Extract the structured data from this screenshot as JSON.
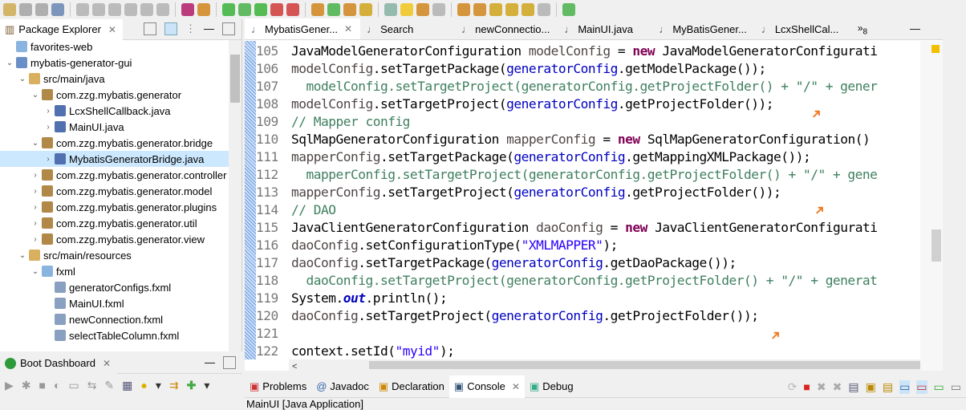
{
  "package_explorer": {
    "title": "Package Explorer",
    "tree": [
      {
        "label": "favorites-web",
        "depth": 0,
        "expanded": null,
        "icon": "folder-icon"
      },
      {
        "label": "mybatis-generator-gui",
        "depth": 0,
        "expanded": true,
        "icon": "maven-project-icon"
      },
      {
        "label": "src/main/java",
        "depth": 1,
        "expanded": true,
        "icon": "source-folder-icon"
      },
      {
        "label": "com.zzg.mybatis.generator",
        "depth": 2,
        "expanded": true,
        "icon": "package-icon"
      },
      {
        "label": "LcxShellCallback.java",
        "depth": 3,
        "expanded": false,
        "icon": "java-file-icon"
      },
      {
        "label": "MainUI.java",
        "depth": 3,
        "expanded": false,
        "icon": "java-file-icon"
      },
      {
        "label": "com.zzg.mybatis.generator.bridge",
        "depth": 2,
        "expanded": true,
        "icon": "package-icon"
      },
      {
        "label": "MybatisGeneratorBridge.java",
        "depth": 3,
        "expanded": false,
        "icon": "java-file-icon",
        "selected": true
      },
      {
        "label": "com.zzg.mybatis.generator.controller",
        "depth": 2,
        "expanded": false,
        "icon": "package-icon"
      },
      {
        "label": "com.zzg.mybatis.generator.model",
        "depth": 2,
        "expanded": false,
        "icon": "package-icon"
      },
      {
        "label": "com.zzg.mybatis.generator.plugins",
        "depth": 2,
        "expanded": false,
        "icon": "package-icon"
      },
      {
        "label": "com.zzg.mybatis.generator.util",
        "depth": 2,
        "expanded": false,
        "icon": "package-icon"
      },
      {
        "label": "com.zzg.mybatis.generator.view",
        "depth": 2,
        "expanded": false,
        "icon": "package-icon"
      },
      {
        "label": "src/main/resources",
        "depth": 1,
        "expanded": true,
        "icon": "source-folder-icon"
      },
      {
        "label": "fxml",
        "depth": 2,
        "expanded": true,
        "icon": "folder-icon"
      },
      {
        "label": "generatorConfigs.fxml",
        "depth": 3,
        "expanded": null,
        "icon": "file-icon"
      },
      {
        "label": "MainUI.fxml",
        "depth": 3,
        "expanded": null,
        "icon": "file-icon"
      },
      {
        "label": "newConnection.fxml",
        "depth": 3,
        "expanded": null,
        "icon": "file-icon"
      },
      {
        "label": "selectTableColumn.fxml",
        "depth": 3,
        "expanded": null,
        "icon": "file-icon"
      }
    ]
  },
  "boot_dashboard": {
    "title": "Boot Dashboard"
  },
  "editor": {
    "tabs": [
      {
        "label": "MybatisGener...",
        "active": true,
        "closable": true
      },
      {
        "label": "Search"
      },
      {
        "label": "newConnectio..."
      },
      {
        "label": "MainUI.java"
      },
      {
        "label": "MyBatisGener..."
      },
      {
        "label": "LcxShellCal..."
      }
    ],
    "overflow_count": "8",
    "lines": [
      {
        "n": "105",
        "seg": [
          [
            "JavaModelGeneratorConfiguration ",
            "plain"
          ],
          [
            "modelConfig",
            "var"
          ],
          [
            " = ",
            "plain"
          ],
          [
            "new",
            "kw"
          ],
          [
            " JavaModelGeneratorConfigurati",
            "plain"
          ]
        ]
      },
      {
        "n": "106",
        "seg": [
          [
            "modelConfig",
            "var"
          ],
          [
            ".setTargetPackage(",
            "plain"
          ],
          [
            "generatorConfig",
            "fld"
          ],
          [
            ".getModelPackage());",
            "plain"
          ]
        ]
      },
      {
        "n": "107",
        "seg": [
          [
            "  modelConfig.setTargetProject(generatorConfig.getProjectFolder() + \"/\" + gener",
            "cm"
          ]
        ]
      },
      {
        "n": "108",
        "seg": [
          [
            "modelConfig",
            "var"
          ],
          [
            ".setTargetProject(",
            "plain"
          ],
          [
            "generatorConfig",
            "fld"
          ],
          [
            ".getProjectFolder());",
            "plain"
          ]
        ]
      },
      {
        "n": "109",
        "seg": [
          [
            "// Mapper config",
            "cm"
          ]
        ]
      },
      {
        "n": "110",
        "seg": [
          [
            "SqlMapGeneratorConfiguration ",
            "plain"
          ],
          [
            "mapperConfig",
            "var"
          ],
          [
            " = ",
            "plain"
          ],
          [
            "new",
            "kw"
          ],
          [
            " SqlMapGeneratorConfiguration()",
            "plain"
          ]
        ]
      },
      {
        "n": "111",
        "seg": [
          [
            "mapperConfig",
            "var"
          ],
          [
            ".setTargetPackage(",
            "plain"
          ],
          [
            "generatorConfig",
            "fld"
          ],
          [
            ".getMappingXMLPackage());",
            "plain"
          ]
        ]
      },
      {
        "n": "112",
        "seg": [
          [
            "  mapperConfig.setTargetProject(generatorConfig.getProjectFolder() + \"/\" + gene",
            "cm"
          ]
        ]
      },
      {
        "n": "113",
        "seg": [
          [
            "mapperConfig",
            "var"
          ],
          [
            ".setTargetProject(",
            "plain"
          ],
          [
            "generatorConfig",
            "fld"
          ],
          [
            ".getProjectFolder());",
            "plain"
          ]
        ]
      },
      {
        "n": "114",
        "seg": [
          [
            "// DAO",
            "cm"
          ]
        ]
      },
      {
        "n": "115",
        "seg": [
          [
            "JavaClientGeneratorConfiguration ",
            "plain"
          ],
          [
            "daoConfig",
            "var"
          ],
          [
            " = ",
            "plain"
          ],
          [
            "new",
            "kw"
          ],
          [
            " JavaClientGeneratorConfigurati",
            "plain"
          ]
        ]
      },
      {
        "n": "116",
        "seg": [
          [
            "daoConfig",
            "var"
          ],
          [
            ".setConfigurationType(",
            "plain"
          ],
          [
            "\"XMLMAPPER\"",
            "str"
          ],
          [
            ");",
            "plain"
          ]
        ]
      },
      {
        "n": "117",
        "seg": [
          [
            "daoConfig",
            "var"
          ],
          [
            ".setTargetPackage(",
            "plain"
          ],
          [
            "generatorConfig",
            "fld"
          ],
          [
            ".getDaoPackage());",
            "plain"
          ]
        ]
      },
      {
        "n": "118",
        "seg": [
          [
            "  daoConfig.setTargetProject(generatorConfig.getProjectFolder() + \"/\" + generat",
            "cm"
          ]
        ]
      },
      {
        "n": "119",
        "seg": [
          [
            "System.",
            "plain"
          ],
          [
            "out",
            "static"
          ],
          [
            ".println();",
            "plain"
          ]
        ]
      },
      {
        "n": "120",
        "seg": [
          [
            "daoConfig",
            "var"
          ],
          [
            ".setTargetProject(",
            "plain"
          ],
          [
            "generatorConfig",
            "fld"
          ],
          [
            ".getProjectFolder());",
            "plain"
          ]
        ]
      },
      {
        "n": "121",
        "seg": []
      },
      {
        "n": "122",
        "seg": [
          [
            "context.setId(",
            "plain"
          ],
          [
            "\"myid\"",
            "str"
          ],
          [
            ");",
            "plain"
          ]
        ]
      }
    ]
  },
  "bottom_panel": {
    "tabs": [
      {
        "label": "Problems",
        "icon": "problems-icon"
      },
      {
        "label": "Javadoc",
        "icon": "at-icon"
      },
      {
        "label": "Declaration",
        "icon": "declaration-icon"
      },
      {
        "label": "Console",
        "icon": "console-icon",
        "active": true
      },
      {
        "label": "Debug",
        "icon": "debug-icon"
      }
    ],
    "console_label": "MainUI [Java Application]"
  },
  "colors": {
    "accent_arrow": "#f07820",
    "keyword": "#7f0055",
    "field": "#0000c0",
    "comment": "#3f7f5f",
    "string": "#2a00ff"
  }
}
